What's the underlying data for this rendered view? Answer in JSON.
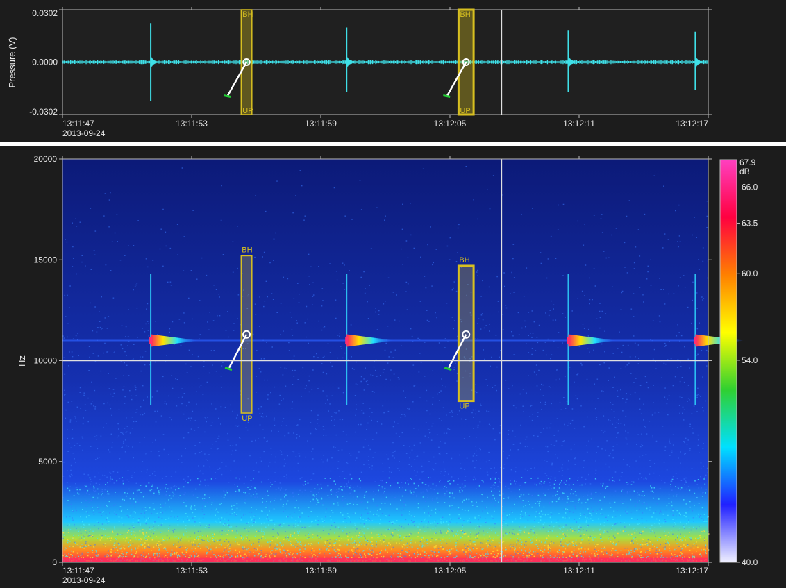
{
  "colors": {
    "background": "#1c1c1c",
    "waveform": "#3fe0e8",
    "annotation_box": "#d8c020",
    "crosshair": "#e0e0e0",
    "handle_end": "#22cc33",
    "separator": "#ffffff"
  },
  "chart_data": [
    {
      "type": "line",
      "title": "",
      "ylabel": "Pressure (V)",
      "xlabel": "",
      "date_label": "2013-09-24",
      "ylim": [
        -0.0302,
        0.0302
      ],
      "xlim_seconds_label_range": [
        "13:11:47",
        "13:12:17"
      ],
      "y_ticks": [
        "0.0302",
        "0.0000",
        "-0.0302"
      ],
      "x_ticks": [
        "13:11:47",
        "13:11:53",
        "13:11:59",
        "13:12:05",
        "13:12:11",
        "13:12:17"
      ],
      "baseline": 0.0,
      "pulses": [
        {
          "time": "13:11:51.1",
          "max": 0.0225,
          "min": -0.0225
        },
        {
          "time": "13:12:00.2",
          "max": 0.02,
          "min": -0.017
        },
        {
          "time": "13:12:10.5",
          "max": 0.0185,
          "min": -0.017
        },
        {
          "time": "13:12:16.4",
          "max": 0.0175,
          "min": -0.016
        }
      ],
      "annotations": [
        {
          "start": "13:11:55.3",
          "end": "13:11:55.8",
          "top_label": "BH",
          "bottom_label": "UP",
          "selected": false
        },
        {
          "start": "13:12:05.4",
          "end": "13:12:06.1",
          "top_label": "BH",
          "bottom_label": "UP",
          "selected": true
        }
      ],
      "cursor_time": "13:12:07.4"
    },
    {
      "type": "heatmap",
      "title": "",
      "ylabel": "Hz",
      "xlabel": "",
      "date_label": "2013-09-24",
      "ylim": [
        0,
        20000
      ],
      "y_ticks": [
        "20000",
        "15000",
        "10000",
        "5000",
        "0"
      ],
      "x_ticks": [
        "13:11:47",
        "13:11:53",
        "13:11:59",
        "13:12:05",
        "13:12:11",
        "13:12:17"
      ],
      "colorbar": {
        "unit": "dB",
        "max_label": "67.9",
        "ticks": [
          "66.0",
          "63.5",
          "60.0",
          "54.0",
          "40.0"
        ],
        "colormap": [
          "#f0f0ff",
          "#2020ff",
          "#00e0ff",
          "#30d030",
          "#ffff00",
          "#ff8000",
          "#ff0040",
          "#ff40c0"
        ]
      },
      "tone_hz": 11000,
      "cursor_freq_hz": 10000,
      "cursor_time": "13:12:07.4",
      "pulses": [
        "13:11:51.1",
        "13:12:00.2",
        "13:12:10.5",
        "13:12:16.4"
      ],
      "annotations": [
        {
          "start": "13:11:55.3",
          "end": "13:11:55.8",
          "low_hz": 7400,
          "high_hz": 15200,
          "top_label": "BH",
          "bottom_label": "UP",
          "selected": false
        },
        {
          "start": "13:12:05.4",
          "end": "13:12:06.1",
          "low_hz": 8000,
          "high_hz": 14700,
          "top_label": "BH",
          "bottom_label": "UP",
          "selected": true
        }
      ]
    }
  ]
}
